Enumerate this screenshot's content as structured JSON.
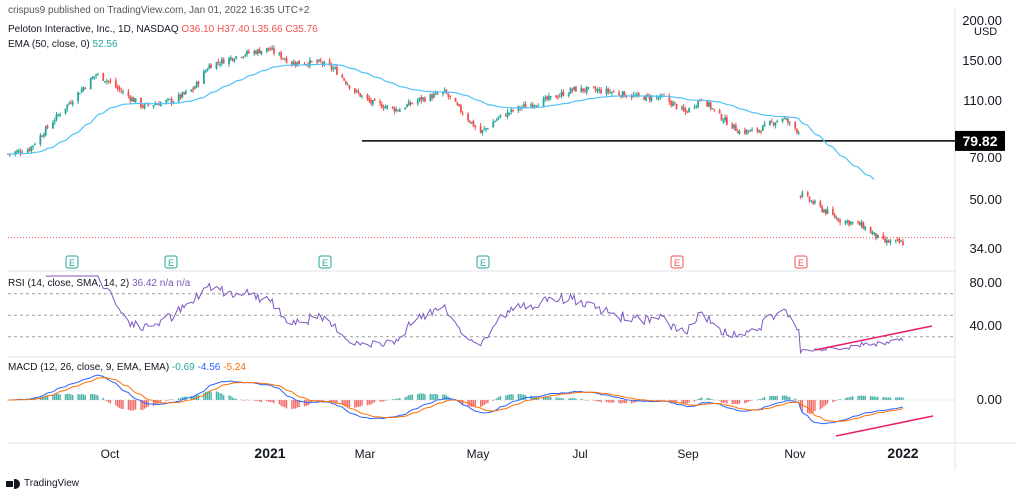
{
  "header": {
    "published": "crispus9 published on TradingView.com, Jan 01, 2022 16:35 UTC+2",
    "symbol": "Peloton Interactive, Inc., 1D, NASDAQ",
    "ohlc": "O36.10 H37.40 L35.66 C35.76",
    "ema_label": "EMA (50, close, 0)",
    "ema_value": "52.56",
    "rsi_label": "RSI (14, close, SMA, 14, 2)",
    "rsi_values": "36.42  n/a  n/a",
    "macd_label": "MACD (12, 26, close, 9, EMA, EMA)",
    "macd_v1": "-0.69",
    "macd_v2": "-4.56",
    "macd_v3": "-5.24"
  },
  "currency": "USD",
  "footer_brand": "TradingView",
  "colors": {
    "up": "#26a69a",
    "down": "#ef5350",
    "ema": "#4fc3f7",
    "rsi": "#7e57c2",
    "macd": "#2962ff",
    "signal": "#ff6d00",
    "trend": "#e91e63",
    "support": "#000000"
  },
  "chart_data": {
    "type": "candlestick",
    "price_axis": {
      "ticks": [
        "200.00",
        "150.00",
        "110.00",
        "70.00",
        "50.00",
        "34.00"
      ],
      "scale": "log",
      "highlight_label": "79.82"
    },
    "support_level": 79.82,
    "last_price_line": 35.76,
    "x_labels": [
      "Oct",
      "2021",
      "Mar",
      "May",
      "Jul",
      "Sep",
      "Nov",
      "2022"
    ],
    "earnings_markers": [
      "E",
      "E",
      "E",
      "E",
      "E",
      "E"
    ],
    "price_anchors": [
      {
        "date": "2020-08-20",
        "close": 72
      },
      {
        "date": "2020-09-01",
        "close": 75
      },
      {
        "date": "2020-09-15",
        "close": 95
      },
      {
        "date": "2020-09-30",
        "close": 120
      },
      {
        "date": "2020-10-08",
        "close": 135
      },
      {
        "date": "2020-10-15",
        "close": 128
      },
      {
        "date": "2020-10-22",
        "close": 118
      },
      {
        "date": "2020-11-03",
        "close": 105
      },
      {
        "date": "2020-11-20",
        "close": 110
      },
      {
        "date": "2020-12-01",
        "close": 120
      },
      {
        "date": "2020-12-10",
        "close": 145
      },
      {
        "date": "2020-12-28",
        "close": 158
      },
      {
        "date": "2021-01-12",
        "close": 165
      },
      {
        "date": "2021-01-25",
        "close": 148
      },
      {
        "date": "2021-02-10",
        "close": 148
      },
      {
        "date": "2021-02-18",
        "close": 140
      },
      {
        "date": "2021-03-01",
        "close": 118
      },
      {
        "date": "2021-03-10",
        "close": 108
      },
      {
        "date": "2021-03-25",
        "close": 102
      },
      {
        "date": "2021-04-05",
        "close": 110
      },
      {
        "date": "2021-04-20",
        "close": 117
      },
      {
        "date": "2021-05-03",
        "close": 95
      },
      {
        "date": "2021-05-10",
        "close": 85
      },
      {
        "date": "2021-05-20",
        "close": 96
      },
      {
        "date": "2021-06-01",
        "close": 104
      },
      {
        "date": "2021-06-15",
        "close": 110
      },
      {
        "date": "2021-07-01",
        "close": 120
      },
      {
        "date": "2021-07-20",
        "close": 118
      },
      {
        "date": "2021-08-05",
        "close": 113
      },
      {
        "date": "2021-08-20",
        "close": 112
      },
      {
        "date": "2021-09-01",
        "close": 100
      },
      {
        "date": "2021-09-10",
        "close": 112
      },
      {
        "date": "2021-09-20",
        "close": 97
      },
      {
        "date": "2021-10-01",
        "close": 86
      },
      {
        "date": "2021-10-10",
        "close": 86
      },
      {
        "date": "2021-10-25",
        "close": 96
      },
      {
        "date": "2021-11-03",
        "close": 86
      },
      {
        "date": "2021-11-05",
        "close": 52
      },
      {
        "date": "2021-11-15",
        "close": 47
      },
      {
        "date": "2021-11-25",
        "close": 43
      },
      {
        "date": "2021-12-08",
        "close": 41
      },
      {
        "date": "2021-12-20",
        "close": 36
      },
      {
        "date": "2021-12-31",
        "close": 35.76
      }
    ],
    "rsi": {
      "axis_ticks": [
        "80.00",
        "40.00"
      ],
      "levels": [
        70,
        50,
        30
      ]
    },
    "macd": {
      "axis_ticks": [
        "0.00"
      ]
    }
  }
}
